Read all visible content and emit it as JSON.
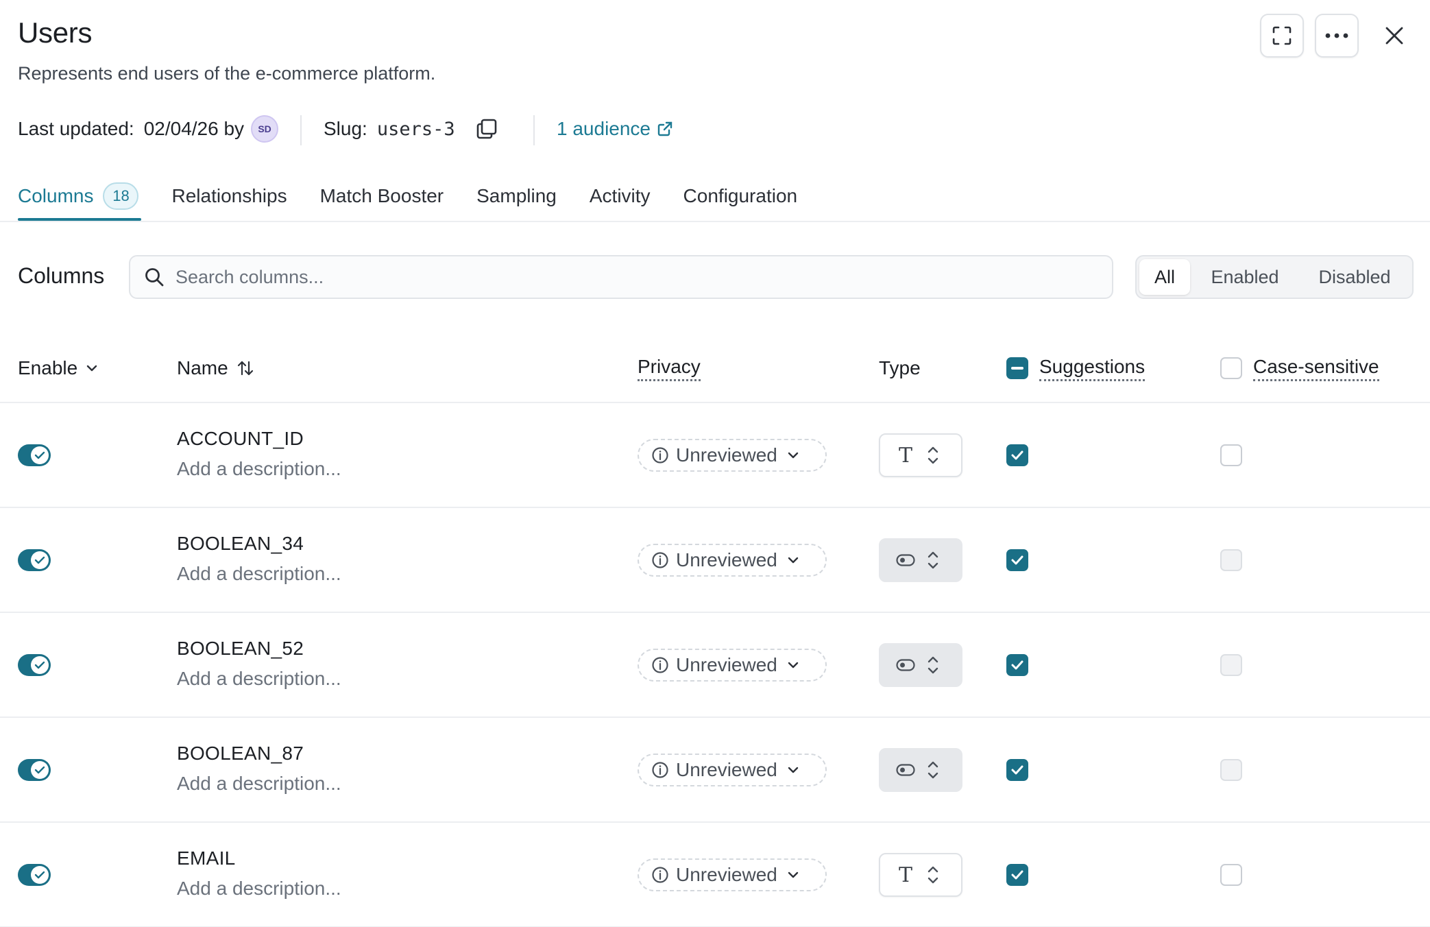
{
  "header": {
    "title": "Users",
    "description": "Represents end users of the e-commerce platform."
  },
  "meta": {
    "last_updated_label": "Last updated:",
    "last_updated_value": "02/04/26 by",
    "avatar_initials": "SD",
    "slug_label": "Slug:",
    "slug_value": "users-3",
    "audience_link": "1 audience"
  },
  "tabs": [
    {
      "label": "Columns",
      "count": "18",
      "active": true
    },
    {
      "label": "Relationships"
    },
    {
      "label": "Match Booster"
    },
    {
      "label": "Sampling"
    },
    {
      "label": "Activity"
    },
    {
      "label": "Configuration"
    }
  ],
  "filter": {
    "section_label": "Columns",
    "search_placeholder": "Search columns...",
    "segments": [
      "All",
      "Enabled",
      "Disabled"
    ],
    "active_segment": "All"
  },
  "table": {
    "headers": {
      "enable": "Enable",
      "name": "Name",
      "privacy": "Privacy",
      "type": "Type",
      "suggestions": "Suggestions",
      "case_sensitive": "Case-sensitive"
    },
    "rows": [
      {
        "name": "ACCOUNT_ID",
        "description": "Add a description...",
        "privacy": "Unreviewed",
        "type": "text",
        "enabled": true,
        "suggestions": true,
        "case_sensitive": false,
        "case_disabled": false
      },
      {
        "name": "BOOLEAN_34",
        "description": "Add a description...",
        "privacy": "Unreviewed",
        "type": "boolean",
        "enabled": true,
        "suggestions": true,
        "case_sensitive": false,
        "case_disabled": true
      },
      {
        "name": "BOOLEAN_52",
        "description": "Add a description...",
        "privacy": "Unreviewed",
        "type": "boolean",
        "enabled": true,
        "suggestions": true,
        "case_sensitive": false,
        "case_disabled": true
      },
      {
        "name": "BOOLEAN_87",
        "description": "Add a description...",
        "privacy": "Unreviewed",
        "type": "boolean",
        "enabled": true,
        "suggestions": true,
        "case_sensitive": false,
        "case_disabled": true
      },
      {
        "name": "EMAIL",
        "description": "Add a description...",
        "privacy": "Unreviewed",
        "type": "text",
        "enabled": true,
        "suggestions": true,
        "case_sensitive": false,
        "case_disabled": false
      }
    ]
  },
  "colors": {
    "accent": "#1c7a93",
    "toggle_on": "#1a6f86"
  },
  "icons": {
    "expand": "expand-icon",
    "more": "more-horizontal-icon",
    "close": "close-icon",
    "copy": "copy-icon",
    "external": "external-link-icon",
    "search": "search-icon",
    "text_type": "text-type-icon",
    "boolean_type": "boolean-type-icon"
  }
}
